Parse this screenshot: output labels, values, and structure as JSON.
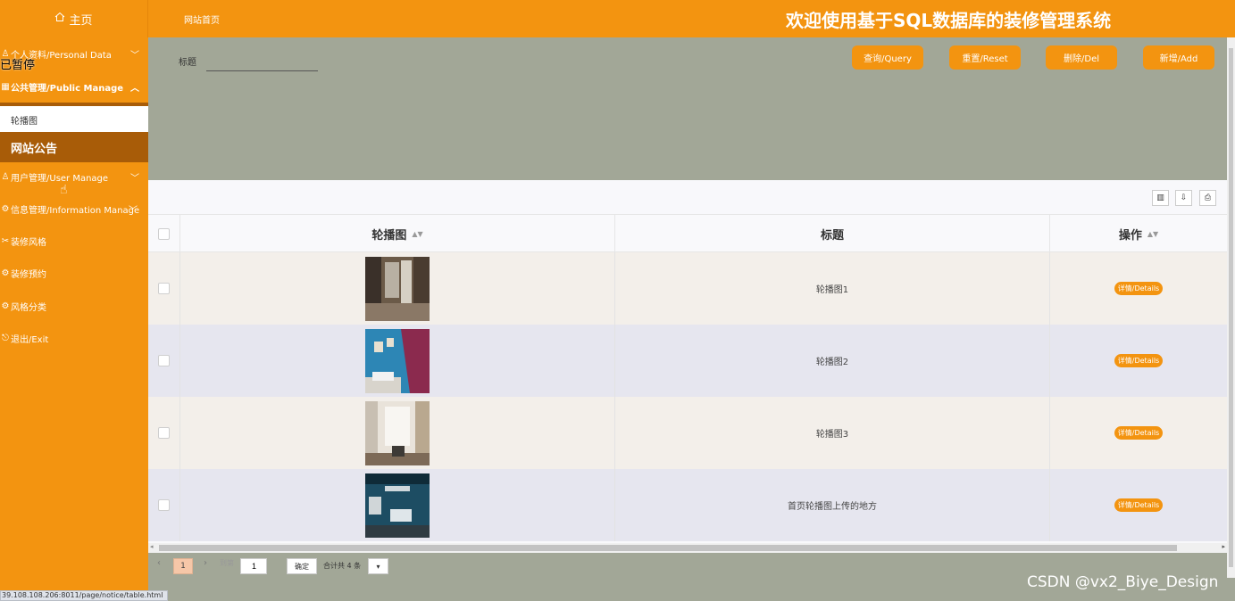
{
  "header": {
    "home_label": "主页",
    "breadcrumb": "网站首页",
    "system_title": "欢迎使用基于SQL数据库的装修管理系统"
  },
  "overlay": {
    "paused_text": "已暂停"
  },
  "sidebar": {
    "items": [
      {
        "label": "个人资料/Personal Data",
        "icon": "person-icon"
      },
      {
        "label": "公共管理/Public Manage",
        "icon": "grid-icon"
      },
      {
        "label": "用户管理/User Manage",
        "icon": "user-icon"
      },
      {
        "label": "信息管理/Information Manage",
        "icon": "gear-icon"
      },
      {
        "label": "装修风格",
        "icon": "wrench-icon"
      },
      {
        "label": "装修预约",
        "icon": "gear-icon"
      },
      {
        "label": "风格分类",
        "icon": "gear-icon"
      },
      {
        "label": "退出/Exit",
        "icon": "exit-icon"
      }
    ],
    "sub_items": [
      {
        "label": "轮播图"
      },
      {
        "label": "网站公告"
      }
    ]
  },
  "search": {
    "label": "标题",
    "value": "",
    "buttons": {
      "query": "查询/Query",
      "reset": "重置/Reset",
      "delete": "删除/Del",
      "add": "新增/Add"
    }
  },
  "table": {
    "columns": [
      "轮播图",
      "标题",
      "操作"
    ],
    "rows": [
      {
        "title": "轮播图1",
        "action": "详情/Details"
      },
      {
        "title": "轮播图2",
        "action": "详情/Details"
      },
      {
        "title": "轮播图3",
        "action": "详情/Details"
      },
      {
        "title": "首页轮播图上传的地方",
        "action": "详情/Details"
      }
    ]
  },
  "pager": {
    "current_page": "1",
    "goto_label": "到第",
    "goto_value": "1",
    "confirm": "确定",
    "total": "合计共 4 条"
  },
  "statusbar": {
    "url": "39.108.108.206:8011/page/notice/table.html"
  },
  "watermark": "CSDN @vx2_Biye_Design",
  "colors": {
    "accent": "#f39410",
    "dark_accent": "#a85c08",
    "content_bg": "#a2a797"
  }
}
